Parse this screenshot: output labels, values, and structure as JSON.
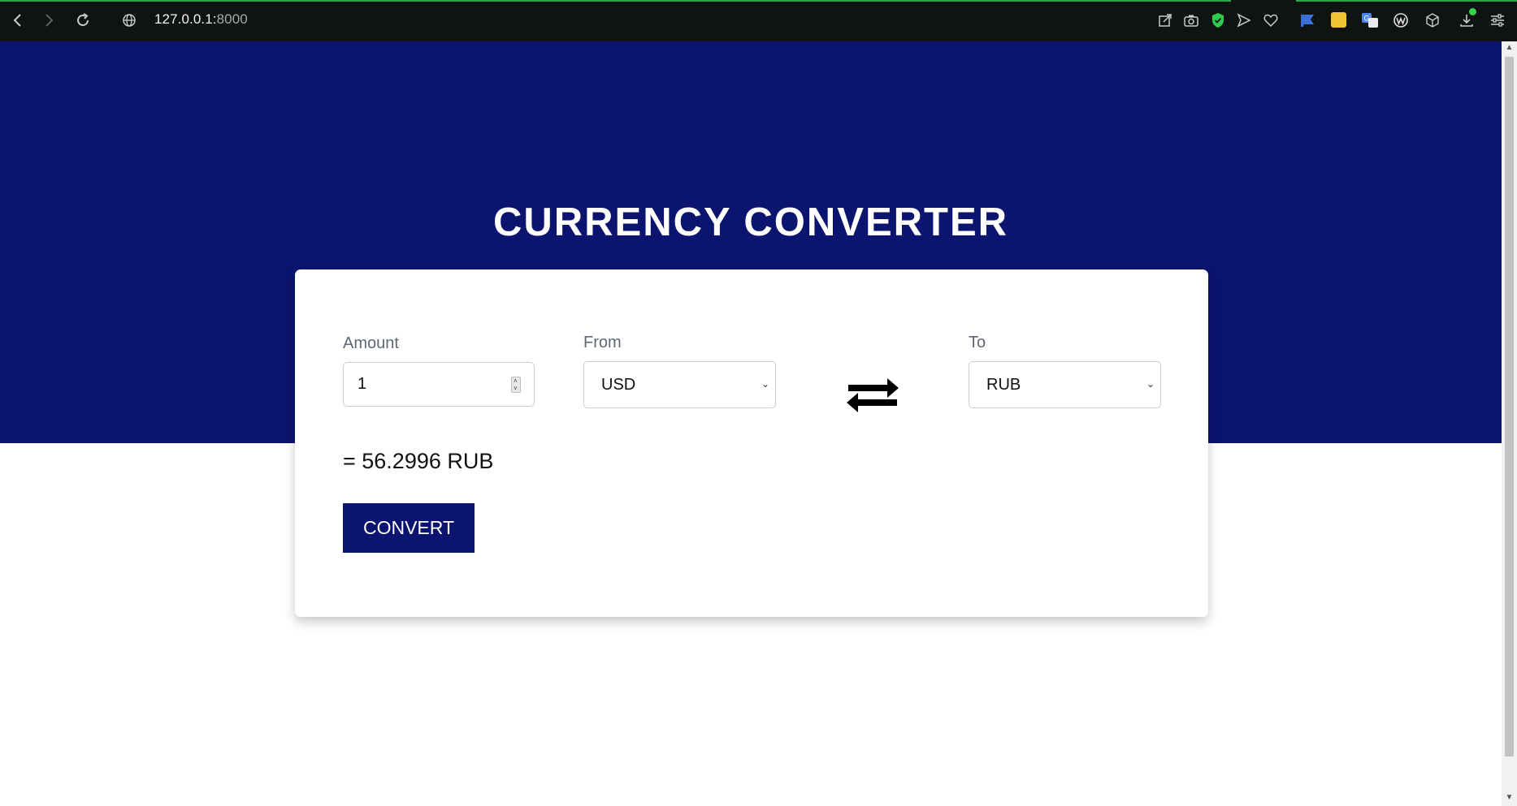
{
  "browser": {
    "url_host": "127.0.0.1:",
    "url_port": "8000",
    "icons": [
      "back-icon",
      "forward-icon",
      "reload-icon",
      "site-info-icon",
      "share-icon",
      "camera-icon",
      "shield-icon",
      "send-icon",
      "heart-icon",
      "flag-extension-icon",
      "notes-extension-icon",
      "translate-extension-icon",
      "w-extension-icon",
      "box-extension-icon",
      "download-icon",
      "settings-icon"
    ],
    "accent": "#2ea843"
  },
  "page": {
    "title": "CURRENCY CONVERTER",
    "hero_color": "#0b146e",
    "amount": {
      "label": "Amount",
      "value": "1"
    },
    "from": {
      "label": "From",
      "value": "USD"
    },
    "to": {
      "label": "To",
      "value": "RUB"
    },
    "swap_icon": "swap-arrows-icon",
    "result": "= 56.2996 RUB",
    "convert_label": "CONVERT"
  }
}
